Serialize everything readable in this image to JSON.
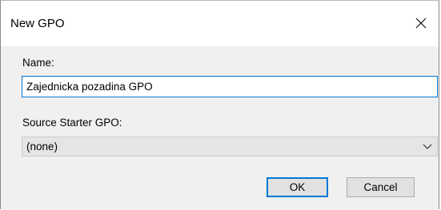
{
  "window": {
    "title": "New GPO",
    "close_icon": "close-icon"
  },
  "form": {
    "name_label": "Name:",
    "name_value": "Zajednicka pozadina GPO",
    "source_label": "Source Starter GPO:",
    "source_value": "(none)",
    "source_dropdown_icon": "chevron-down-icon"
  },
  "buttons": {
    "ok_label": "OK",
    "cancel_label": "Cancel"
  },
  "colors": {
    "focus_border": "#0078d7",
    "client_bg": "#f0f0f0",
    "button_bg": "#e1e1e1"
  }
}
